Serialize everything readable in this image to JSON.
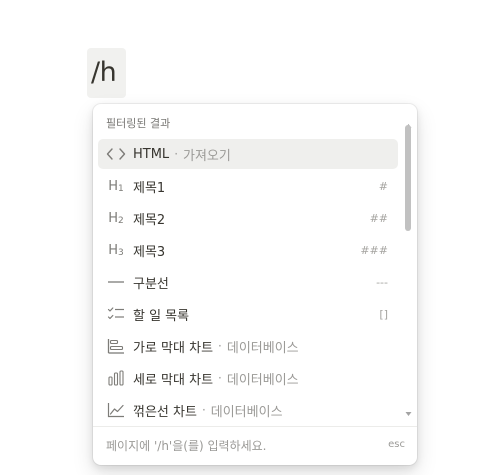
{
  "editor": {
    "slash_text": "/h"
  },
  "menu": {
    "section_title": "필터링된 결과",
    "items": [
      {
        "icon": "code-icon",
        "label": "HTML",
        "sub": "가져오기",
        "shortcut": "",
        "selected": true
      },
      {
        "icon": "heading1-icon",
        "label": "제목1",
        "sub": "",
        "shortcut": "#"
      },
      {
        "icon": "heading2-icon",
        "label": "제목2",
        "sub": "",
        "shortcut": "##"
      },
      {
        "icon": "heading3-icon",
        "label": "제목3",
        "sub": "",
        "shortcut": "###"
      },
      {
        "icon": "divider-icon",
        "label": "구분선",
        "sub": "",
        "shortcut": "---"
      },
      {
        "icon": "checklist-icon",
        "label": "할 일 목록",
        "sub": "",
        "shortcut": "[]"
      },
      {
        "icon": "horizontal-bar-chart-icon",
        "label": "가로 막대 차트",
        "sub": "데이터베이스",
        "shortcut": ""
      },
      {
        "icon": "vertical-bar-chart-icon",
        "label": "세로 막대 차트",
        "sub": "데이터베이스",
        "shortcut": ""
      },
      {
        "icon": "line-chart-icon",
        "label": "꺾은선 차트",
        "sub": "데이터베이스",
        "shortcut": ""
      }
    ],
    "sep": "·",
    "heading_letter": "H",
    "heading_nums": [
      "1",
      "2",
      "3"
    ],
    "footer_hint": "페이지에 '/h'을(를) 입력하세요.",
    "footer_esc": "esc"
  }
}
